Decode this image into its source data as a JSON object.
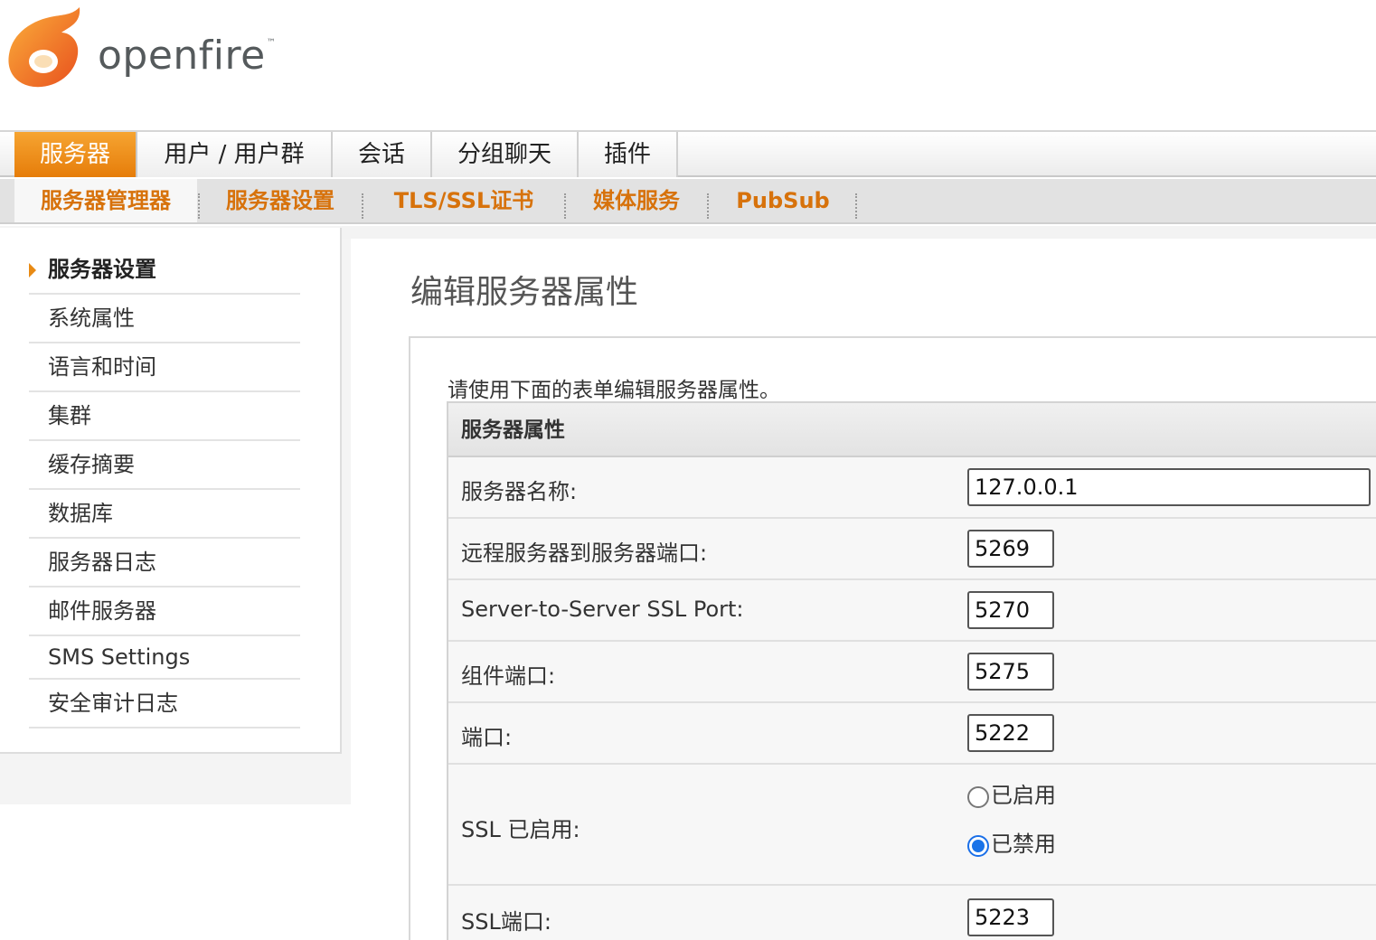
{
  "brand": {
    "name": "openfire",
    "tm": "™"
  },
  "main_tabs": [
    {
      "label": "服务器",
      "active": true
    },
    {
      "label": "用户 / 用户群",
      "active": false
    },
    {
      "label": "会话",
      "active": false
    },
    {
      "label": "分组聊天",
      "active": false
    },
    {
      "label": "插件",
      "active": false
    }
  ],
  "sub_tabs": [
    {
      "label": "服务器管理器",
      "active": true
    },
    {
      "label": "服务器设置",
      "active": false
    },
    {
      "label": "TLS/SSL证书",
      "active": false
    },
    {
      "label": "媒体服务",
      "active": false
    },
    {
      "label": "PubSub",
      "active": false
    }
  ],
  "sidebar": {
    "items": [
      {
        "label": "服务器设置",
        "active": true
      },
      {
        "label": "系统属性",
        "active": false
      },
      {
        "label": "语言和时间",
        "active": false
      },
      {
        "label": "集群",
        "active": false
      },
      {
        "label": "缓存摘要",
        "active": false
      },
      {
        "label": "数据库",
        "active": false
      },
      {
        "label": "服务器日志",
        "active": false
      },
      {
        "label": "邮件服务器",
        "active": false
      },
      {
        "label": "SMS Settings",
        "active": false
      },
      {
        "label": "安全审计日志",
        "active": false
      }
    ]
  },
  "main": {
    "title": "编辑服务器属性",
    "intro": "请使用下面的表单编辑服务器属性。",
    "table_header": "服务器属性",
    "fields": [
      {
        "label": "服务器名称:",
        "value": "127.0.0.1"
      },
      {
        "label": "远程服务器到服务器端口:",
        "value": "5269"
      },
      {
        "label": "Server-to-Server SSL Port:",
        "value": "5270"
      },
      {
        "label": "组件端口:",
        "value": "5275"
      },
      {
        "label": "端口:",
        "value": "5222"
      }
    ],
    "ssl_enabled": {
      "label": "SSL 已启用:",
      "options": [
        {
          "label": "已启用",
          "checked": false
        },
        {
          "label": "已禁用",
          "checked": true
        }
      ]
    },
    "ssl_port": {
      "label": "SSL端口:",
      "value": "5223"
    }
  },
  "colors": {
    "accent": "#e67d0a",
    "subtab_text": "#d7720b",
    "radio_checked": "#1a73e8"
  }
}
